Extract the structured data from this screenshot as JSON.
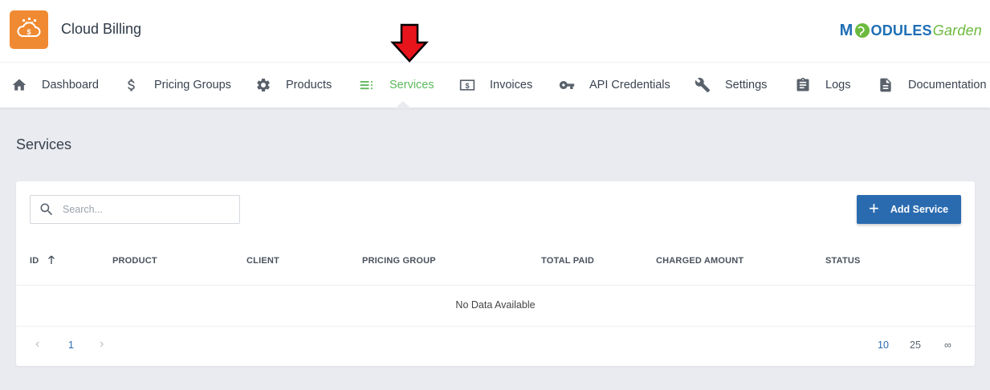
{
  "app": {
    "title": "Cloud Billing",
    "brand": {
      "m": "M",
      "odules": "ODULES",
      "garden": "Garden"
    }
  },
  "nav": {
    "items": [
      {
        "label": "Dashboard",
        "icon": "home-icon"
      },
      {
        "label": "Pricing Groups",
        "icon": "dollar-icon"
      },
      {
        "label": "Products",
        "icon": "gear-icon"
      },
      {
        "label": "Services",
        "icon": "list-icon",
        "active": true
      },
      {
        "label": "Invoices",
        "icon": "invoice-icon"
      },
      {
        "label": "API Credentials",
        "icon": "key-icon"
      },
      {
        "label": "Settings",
        "icon": "wrench-icon"
      },
      {
        "label": "Logs",
        "icon": "clipboard-icon"
      },
      {
        "label": "Documentation",
        "icon": "document-icon"
      }
    ]
  },
  "page": {
    "title": "Services"
  },
  "toolbar": {
    "search_placeholder": "Search...",
    "search_value": "",
    "add_label": "Add Service"
  },
  "table": {
    "columns": [
      "ID",
      "PRODUCT",
      "CLIENT",
      "PRICING GROUP",
      "TOTAL PAID",
      "CHARGED AMOUNT",
      "STATUS"
    ],
    "sort": {
      "column": "ID",
      "direction": "ascending"
    },
    "empty_text": "No Data Available"
  },
  "pagination": {
    "current_page": "1",
    "page_sizes": [
      "10",
      "25",
      "∞"
    ],
    "active_size": "10"
  },
  "colors": {
    "accent": "#5cb85c",
    "primary": "#2a6bb0",
    "logo": "#f08a32",
    "arrow": "#e8141c"
  }
}
